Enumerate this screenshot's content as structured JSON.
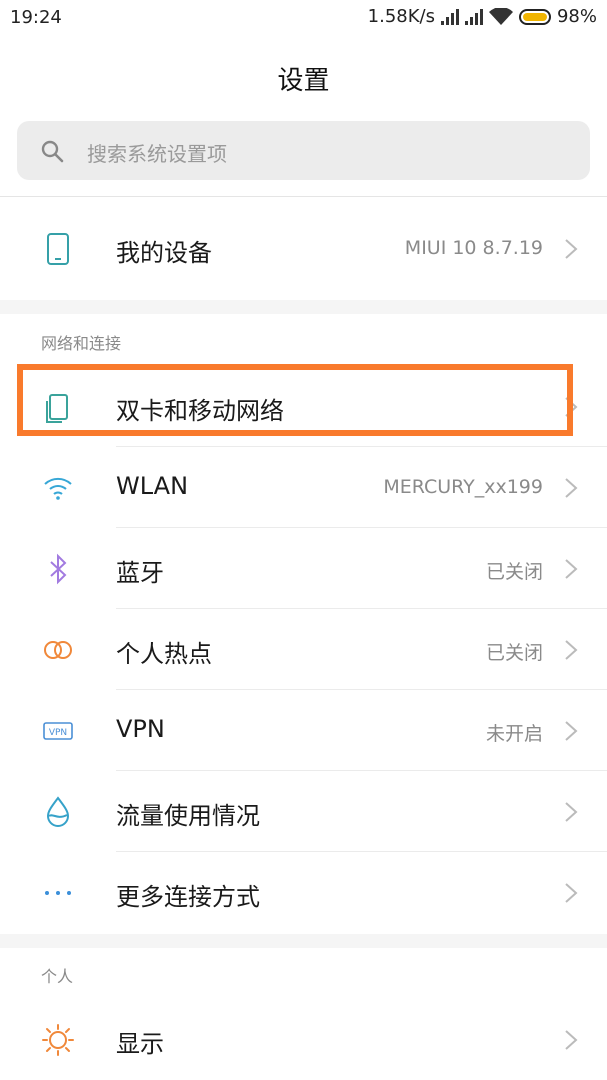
{
  "status_bar": {
    "time": "19:24",
    "net_speed": "1.58K/s",
    "battery": "98%",
    "battery_level": 0.98,
    "battery_color": "#f0b400"
  },
  "header": {
    "title": "设置"
  },
  "search": {
    "placeholder": "搜索系统设置项"
  },
  "my_device": {
    "label": "我的设备",
    "value": "MIUI 10 8.7.19",
    "icon": "phone-icon"
  },
  "network_section": {
    "header": "网络和连接",
    "items": [
      {
        "label": "双卡和移动网络",
        "value": "",
        "icon": "sim-cards-icon",
        "color": "#3aa39b"
      },
      {
        "label": "WLAN",
        "value": "MERCURY_xx199",
        "icon": "wifi-icon",
        "color": "#37a7d6"
      },
      {
        "label": "蓝牙",
        "value": "已关闭",
        "icon": "bluetooth-icon",
        "color": "#a27be0"
      },
      {
        "label": "个人热点",
        "value": "已关闭",
        "icon": "hotspot-icon",
        "color": "#f0883a"
      },
      {
        "label": "VPN",
        "value": "未开启",
        "icon": "vpn-icon",
        "color": "#4a8fd6"
      },
      {
        "label": "流量使用情况",
        "value": "",
        "icon": "data-usage-icon",
        "color": "#36a2c9"
      },
      {
        "label": "更多连接方式",
        "value": "",
        "icon": "more-dots-icon",
        "color": "#3b8fd9"
      }
    ]
  },
  "personal_section": {
    "header": "个人",
    "items": [
      {
        "label": "显示",
        "value": "",
        "icon": "display-sun-icon",
        "color": "#f0883a"
      }
    ]
  },
  "highlight_color": "#f97a2c"
}
